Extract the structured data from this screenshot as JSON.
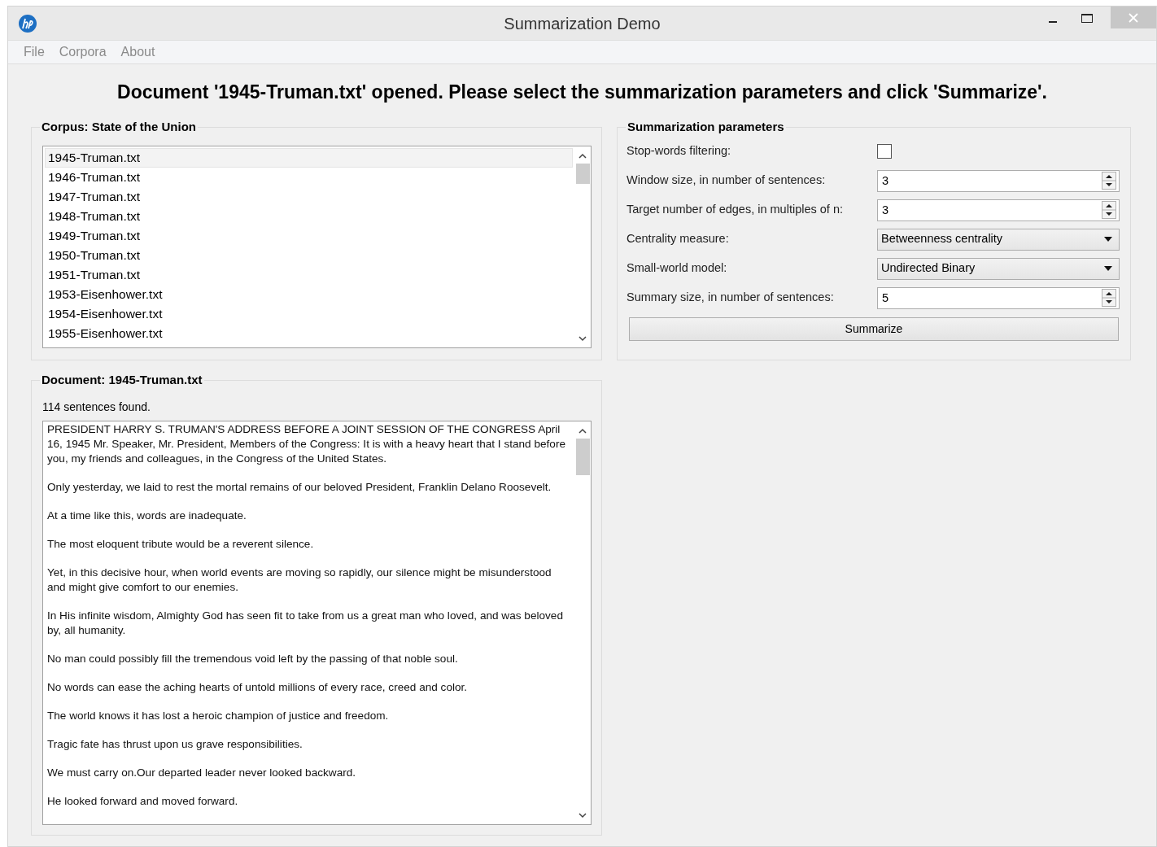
{
  "window": {
    "title": "Summarization Demo"
  },
  "menu": [
    {
      "label": "File"
    },
    {
      "label": "Corpora"
    },
    {
      "label": "About"
    }
  ],
  "headline": "Document '1945-Truman.txt' opened. Please select the summarization parameters and click 'Summarize'.",
  "corpus": {
    "title": "Corpus: State of the Union",
    "files": [
      {
        "name": "1945-Truman.txt",
        "selected": true
      },
      {
        "name": "1946-Truman.txt",
        "selected": false
      },
      {
        "name": "1947-Truman.txt",
        "selected": false
      },
      {
        "name": "1948-Truman.txt",
        "selected": false
      },
      {
        "name": "1949-Truman.txt",
        "selected": false
      },
      {
        "name": "1950-Truman.txt",
        "selected": false
      },
      {
        "name": "1951-Truman.txt",
        "selected": false
      },
      {
        "name": "1953-Eisenhower.txt",
        "selected": false
      },
      {
        "name": "1954-Eisenhower.txt",
        "selected": false
      },
      {
        "name": "1955-Eisenhower.txt",
        "selected": false
      }
    ]
  },
  "parameters": {
    "title": "Summarization parameters",
    "fields": [
      {
        "kind": "checkbox",
        "label": "Stop-words filtering:",
        "checked": false
      },
      {
        "kind": "spinbox",
        "label": "Window size, in number of sentences:",
        "value": "3"
      },
      {
        "kind": "spinbox",
        "label": "Target number of edges, in multiples of n:",
        "value": "3"
      },
      {
        "kind": "dropdown",
        "label": "Centrality measure:",
        "value": "Betweenness centrality"
      },
      {
        "kind": "dropdown",
        "label": "Small-world model:",
        "value": "Undirected Binary"
      },
      {
        "kind": "spinbox",
        "label": "Summary size, in number of sentences:",
        "value": "5"
      }
    ],
    "button": "Summarize"
  },
  "document": {
    "title": "Document: 1945-Truman.txt",
    "status": "114 sentences found.",
    "paragraphs": [
      "PRESIDENT HARRY S. TRUMAN'S ADDRESS BEFORE A JOINT SESSION OF THE CONGRESS April 16, 1945 Mr. Speaker, Mr. President, Members of the Congress: It is with a heavy heart that I stand before you, my friends and colleagues, in the Congress of the United States.",
      "Only yesterday, we laid to rest the mortal remains of our beloved President, Franklin Delano Roosevelt.",
      "At a time like this, words are inadequate.",
      "The most eloquent tribute would be a reverent silence.",
      "Yet, in this decisive hour, when world events are moving so rapidly, our silence might be misunderstood and might give comfort to our enemies.",
      "In His infinite wisdom, Almighty God has seen fit to take from us a great man who loved, and was beloved by, all humanity.",
      "No man could possibly fill the tremendous void left by the passing of that noble soul.",
      "No words can ease the aching hearts of untold millions of every race, creed and color.",
      "The world knows it has lost a heroic champion of justice and freedom.",
      "Tragic fate has thrust upon us grave responsibilities.",
      "We must carry on.Our departed leader never looked backward.",
      "He looked forward and moved forward."
    ]
  }
}
